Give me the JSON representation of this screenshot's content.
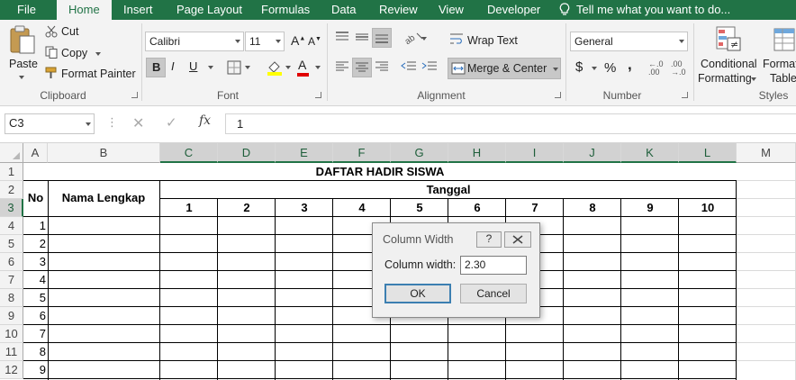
{
  "menu": {
    "tabs": [
      "File",
      "Home",
      "Insert",
      "Page Layout",
      "Formulas",
      "Data",
      "Review",
      "View",
      "Developer"
    ],
    "tell_me": "Tell me what you want to do..."
  },
  "ribbon": {
    "clipboard": {
      "paste": "Paste",
      "cut": "Cut",
      "copy": "Copy",
      "format_painter": "Format Painter",
      "label": "Clipboard"
    },
    "font": {
      "name": "Calibri",
      "size": "11",
      "bold": "B",
      "italic": "I",
      "underline": "U",
      "font_color_letter": "A",
      "label": "Font"
    },
    "alignment": {
      "wrap_text": "Wrap Text",
      "merge_center": "Merge & Center",
      "label": "Alignment"
    },
    "number": {
      "format": "General",
      "currency": "$",
      "percent": "%",
      "comma": ",",
      "label": "Number"
    },
    "styles": {
      "conditional_line1": "Conditional",
      "conditional_line2": "Formatting",
      "format_table_line1": "Format",
      "format_table_line2": "Table",
      "label": "Styles"
    }
  },
  "formula_bar": {
    "name_box": "C3",
    "fx": "fx",
    "value": "1"
  },
  "sheet": {
    "columns": [
      "A",
      "B",
      "C",
      "D",
      "E",
      "F",
      "G",
      "H",
      "I",
      "J",
      "K",
      "L",
      "M"
    ],
    "rows": [
      "1",
      "2",
      "3",
      "4",
      "5",
      "6",
      "7",
      "8",
      "9",
      "10",
      "11",
      "12"
    ],
    "title": "DAFTAR HADIR SISWA",
    "no_header": "No",
    "name_header": "Nama Lengkap",
    "date_header": "Tanggal",
    "dates": [
      "1",
      "2",
      "3",
      "4",
      "5",
      "6",
      "7",
      "8",
      "9",
      "10"
    ],
    "numbers": [
      "1",
      "2",
      "3",
      "4",
      "5",
      "6",
      "7",
      "8",
      "9"
    ]
  },
  "dialog": {
    "title": "Column Width",
    "help": "?",
    "field_label": "Column width:",
    "value": "2.30",
    "ok": "OK",
    "cancel": "Cancel"
  }
}
